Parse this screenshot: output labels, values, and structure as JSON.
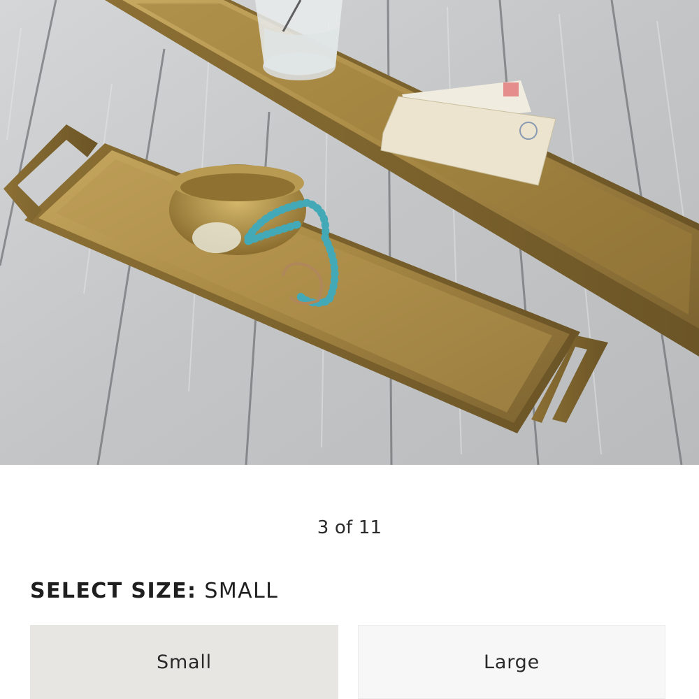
{
  "gallery": {
    "image_alt": "Antique brass rectangular trays with handles on a whitewashed wood floor",
    "pager_text": "3 of 11"
  },
  "size_selector": {
    "heading_label": "SELECT SIZE:",
    "heading_value": "SMALL",
    "options": [
      {
        "label": "Small",
        "selected": true
      },
      {
        "label": "Large",
        "selected": false
      }
    ]
  },
  "colors": {
    "page_background": "#ffffff",
    "selected_option_bg": "#e8e6e3",
    "unselected_option_bg": "#f7f7f7",
    "brass": "#a98a45",
    "wood": "#c7c9cb"
  }
}
